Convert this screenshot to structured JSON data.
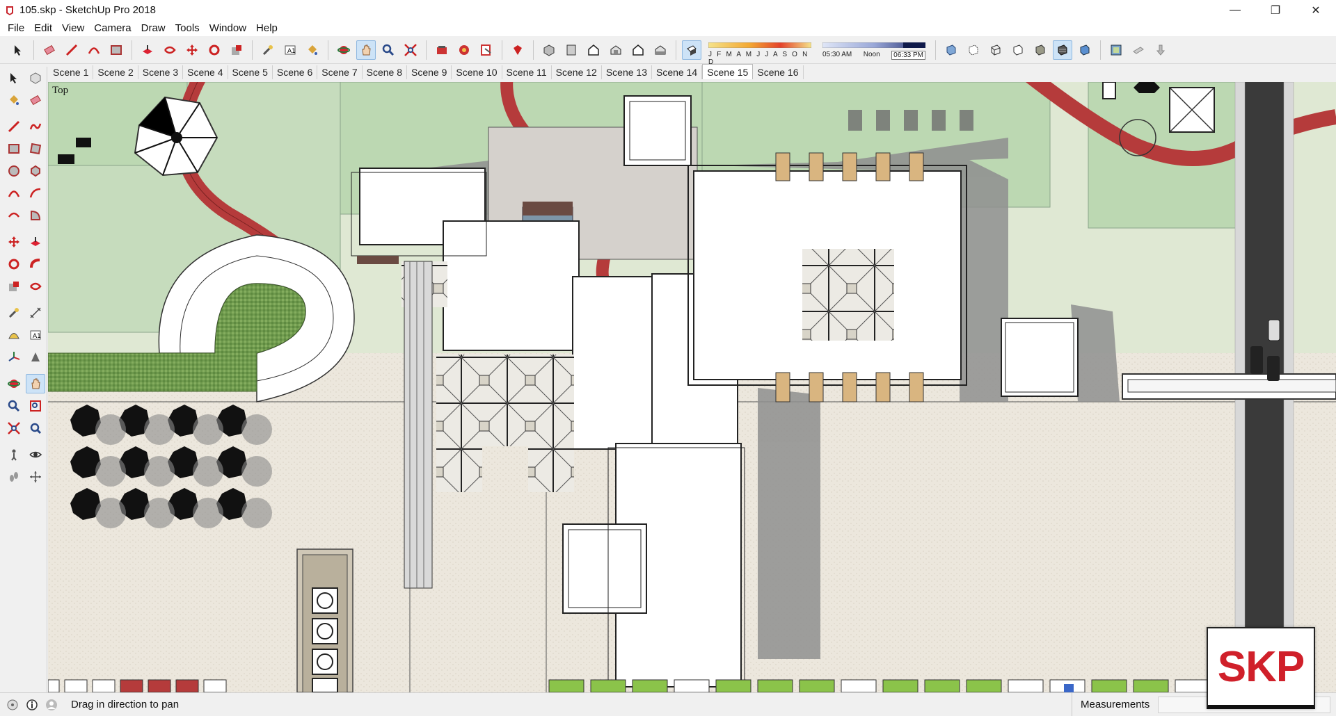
{
  "window": {
    "title": "105.skp - SketchUp Pro 2018",
    "minimize": "—",
    "restore": "❐",
    "close": "✕"
  },
  "menu": [
    "File",
    "Edit",
    "View",
    "Camera",
    "Draw",
    "Tools",
    "Window",
    "Help"
  ],
  "toolbar": {
    "icons": [
      "select-icon",
      "eraser-icon",
      "line-icon",
      "arc-icon",
      "rectangle-icon",
      "push-pull-icon",
      "offset-icon",
      "move-icon",
      "rotate-icon",
      "scale-icon",
      "tape-measure-icon",
      "text-icon",
      "paint-bucket-icon",
      "orbit-icon",
      "pan-icon",
      "zoom-icon",
      "zoom-extents-icon",
      "warehouse-icon",
      "extension-warehouse-icon",
      "layout-icon",
      "ruby-icon",
      "iso-view-icon",
      "top-view-icon",
      "front-view-icon",
      "right-view-icon",
      "back-view-icon",
      "left-view-icon",
      "shadows-toggle-icon"
    ],
    "shadow_months": "J F M A M J J A S O N D",
    "time_start": "05:30 AM",
    "time_mid": "Noon",
    "time_end": "06:33 PM",
    "style_icons": [
      "xray-icon",
      "back-edges-icon",
      "wireframe-icon",
      "hidden-line-icon",
      "shaded-icon",
      "shaded-textures-icon",
      "monochrome-icon",
      "model-info-icon",
      "section-plane-icon",
      "section-cut-icon"
    ]
  },
  "scenes": {
    "tabs": [
      "Scene 1",
      "Scene 2",
      "Scene 3",
      "Scene 4",
      "Scene 5",
      "Scene 6",
      "Scene 7",
      "Scene 8",
      "Scene 9",
      "Scene 10",
      "Scene 11",
      "Scene 12",
      "Scene 13",
      "Scene 14",
      "Scene 15",
      "Scene 16"
    ],
    "active": "Scene 15"
  },
  "left_tools": [
    "select-tool",
    "component-tool",
    "paint-tool",
    "eraser-tool",
    "line-tool",
    "freehand-tool",
    "rectangle-tool",
    "rotated-rectangle-tool",
    "circle-tool",
    "polygon-tool",
    "arc-tool",
    "two-point-arc-tool",
    "three-point-arc-tool",
    "pie-tool",
    "move-tool",
    "push-pull-tool",
    "rotate-tool",
    "follow-me-tool",
    "scale-tool",
    "offset-tool",
    "tape-measure-tool",
    "dimension-tool",
    "protractor-tool",
    "text-tool",
    "axes-tool",
    "3d-text-tool",
    "orbit-tool",
    "pan-tool",
    "zoom-tool",
    "zoom-window-tool",
    "zoom-extents-tool",
    "previous-view-tool",
    "position-camera-tool",
    "look-around-tool",
    "walk-tool",
    "section-plane-tool"
  ],
  "viewport": {
    "view_label": "Top"
  },
  "status": {
    "message": "Drag in direction to pan",
    "measurements_label": "Measurements",
    "measurements_value": ""
  },
  "badge": {
    "text": "SKP"
  },
  "colors": {
    "grass_light": "#dfe8d3",
    "lawn_mint": "#bcd8b2",
    "path_red": "#b53b3b",
    "paving": "#ebe6dc",
    "building_white": "#ffffff",
    "shadow": "#8d8d8d",
    "road": "#3a3a3a",
    "accent_red": "#d0202a"
  }
}
